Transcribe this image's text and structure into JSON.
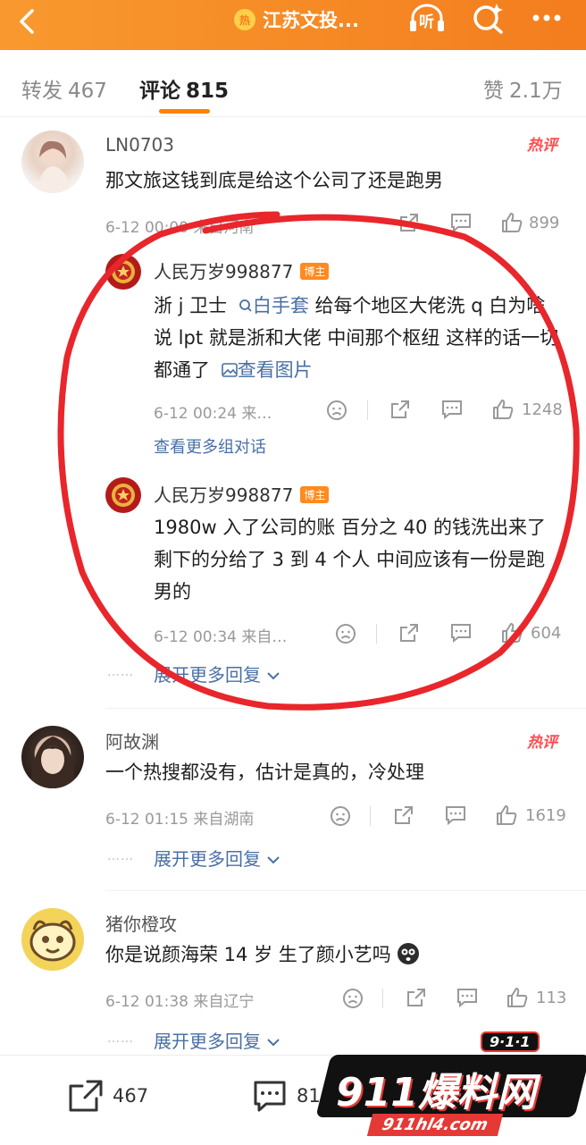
{
  "topbar": {
    "title": "江苏文投...",
    "hot_badge": "热",
    "back_icon": "chevron-left-icon",
    "listen_label": "听",
    "search_icon": "search-spark-icon",
    "more_icon": "more-dots-icon",
    "bg_color": "#f47d1e"
  },
  "tabs": [
    {
      "label": "转发",
      "count": "467"
    },
    {
      "label": "评论",
      "count": "815"
    },
    {
      "label": "赞",
      "count": "2.1万"
    }
  ],
  "comments": [
    {
      "user": "LN0703",
      "text": "那文旅这钱到底是给这个公司了还是跑男",
      "meta": "6-12 00:00 来自河南",
      "likes": "899",
      "hot_label": "热评"
    },
    {
      "user": "阿故渊",
      "text": "一个热搜都没有，估计是真的，冷处理",
      "meta": "6-12 01:15 来自湖南",
      "likes": "1619",
      "hot_label": "热评",
      "expand": "展开更多回复"
    },
    {
      "user": "猪你橙攻",
      "text": "你是说颜海荣 14 岁 生了颜小艺吗",
      "meta": "6-12 01:38 来自辽宁",
      "likes": "113",
      "expand": "展开更多回复"
    }
  ],
  "replies": [
    {
      "user": "人民万岁998877",
      "badge": "博主",
      "text_pre": "浙 j 卫士",
      "link": "白手套",
      "text_mid": " 给每个地区大佬洗 q  白为啥说 lpt 就是浙和大佬 中间那个枢纽 这样的话一切都通了",
      "image_link": "查看图片",
      "meta": "6-12 00:24 来…",
      "likes": "1248",
      "more": "查看更多组对话"
    },
    {
      "user": "人民万岁998877",
      "badge": "博主",
      "text": "1980w 入了公司的账 百分之 40 的钱洗出来了 剩下的分给了 3 到 4 个人 中间应该有一份是跑男的",
      "meta": "6-12 00:34 来自…",
      "likes": "604"
    }
  ],
  "first_thread_expand": "展开更多回复",
  "dots": "……",
  "bottom": {
    "repost": "467",
    "comment": "81"
  },
  "watermark": {
    "tag": "9·1·1",
    "text": "911爆料网",
    "url": "911hl4.com"
  },
  "colors": {
    "accent": "#ff8200",
    "link": "#4a6fa5",
    "annotation": "#e8262b"
  }
}
